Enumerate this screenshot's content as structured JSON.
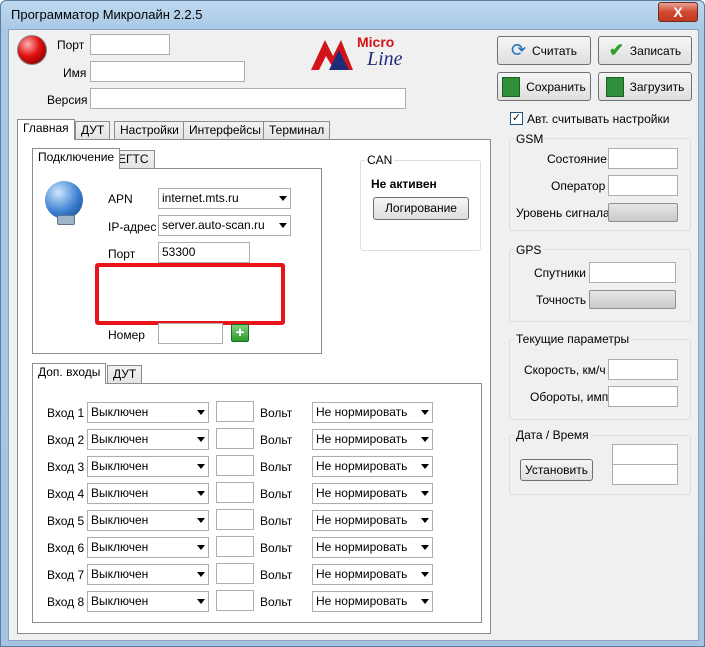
{
  "window": {
    "title": "Программатор Микролайн 2.2.5",
    "close_label": "X"
  },
  "header": {
    "port_label": "Порт",
    "port_value": "",
    "name_label": "Имя",
    "name_value": "",
    "version_label": "Версия",
    "version_value": ""
  },
  "logo": {
    "line1": "Micro",
    "line2": "Line"
  },
  "actions": {
    "read": "Считать",
    "write": "Записать",
    "save": "Сохранить",
    "load": "Загрузить"
  },
  "main_tabs": [
    "Главная",
    "ДУТ",
    "Настройки",
    "Интерфейсы",
    "Терминал"
  ],
  "sub_tabs": [
    "Подключение",
    "ЕГТС"
  ],
  "connection": {
    "apn_label": "APN",
    "apn_value": "internet.mts.ru",
    "ip_label": "IP-адрес",
    "ip_value": "server.auto-scan.ru",
    "port_label": "Порт",
    "port_value": "53300",
    "number_label": "Номер",
    "number_value": "",
    "add_symbol": "+"
  },
  "can": {
    "title": "CAN",
    "status": "Не активен",
    "log_button": "Логирование"
  },
  "bottom_tabs": [
    "Доп. входы",
    "ДУТ"
  ],
  "inputs": {
    "volt_label": "Вольт",
    "rows": [
      {
        "label": "Вход 1",
        "mode": "Выключен",
        "value": "",
        "norm": "Не нормировать"
      },
      {
        "label": "Вход 2",
        "mode": "Выключен",
        "value": "",
        "norm": "Не нормировать"
      },
      {
        "label": "Вход 3",
        "mode": "Выключен",
        "value": "",
        "norm": "Не нормировать"
      },
      {
        "label": "Вход 4",
        "mode": "Выключен",
        "value": "",
        "norm": "Не нормировать"
      },
      {
        "label": "Вход 5",
        "mode": "Выключен",
        "value": "",
        "norm": "Не нормировать"
      },
      {
        "label": "Вход 6",
        "mode": "Выключен",
        "value": "",
        "norm": "Не нормировать"
      },
      {
        "label": "Вход 7",
        "mode": "Выключен",
        "value": "",
        "norm": "Не нормировать"
      },
      {
        "label": "Вход 8",
        "mode": "Выключен",
        "value": "",
        "norm": "Не нормировать"
      }
    ]
  },
  "auto_read": {
    "checked_symbol": "✓",
    "label": "Авт. считывать настройки"
  },
  "gsm": {
    "title": "GSM",
    "state_label": "Состояние",
    "operator_label": "Оператор",
    "signal_label": "Уровень сигнала"
  },
  "gps": {
    "title": "GPS",
    "satellites_label": "Спутники",
    "accuracy_label": "Точность"
  },
  "current": {
    "title": "Текущие параметры",
    "speed_label": "Скорость, км/ч",
    "rpm_label": "Обороты, имп"
  },
  "datetime": {
    "title": "Дата / Время",
    "set_button": "Установить"
  },
  "colors": {
    "accent_red": "#e8141a",
    "logo_red": "#d0141a",
    "logo_blue": "#1e2d7a"
  }
}
